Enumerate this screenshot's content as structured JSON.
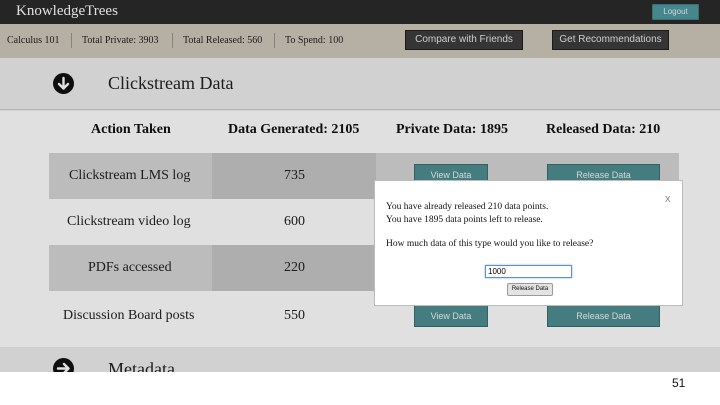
{
  "app": {
    "brand": "KnowledgeTrees",
    "logout_label": "Logout"
  },
  "stats": {
    "course": "Calculus 101",
    "total_private": "Total Private: 3903",
    "total_released": "Total Released: 560",
    "to_spend": "To Spend: 100",
    "compare_label": "Compare with Friends",
    "recommend_label": "Get Recommendations"
  },
  "clickstream": {
    "title": "Clickstream Data",
    "icon": "arrow-down-circle-icon",
    "columns": [
      "Action Taken",
      "Data Generated: 2105",
      "Private Data: 1895",
      "Released Data: 210"
    ],
    "rows": [
      {
        "action": "Clickstream LMS log",
        "generated": "735",
        "view_label": "View Data",
        "release_label": "Release Data"
      },
      {
        "action": "Clickstream video log",
        "generated": "600"
      },
      {
        "action": "PDFs accessed",
        "generated": "220"
      },
      {
        "action": "Discussion Board posts",
        "generated": "550",
        "view_label": "View Data",
        "release_label": "Release Data"
      }
    ]
  },
  "metadata": {
    "title": "Metadata",
    "icon": "arrow-right-circle-icon"
  },
  "modal": {
    "close": "x",
    "line1": "You have already released 210 data points.",
    "line2": "You have 1895 data points left to release.",
    "question": "How much data of this type would you like to release?",
    "input_value": "1000",
    "button_label": "Release Data"
  },
  "slide_number": "51",
  "colors": {
    "navbar": "#2b2b2b",
    "statsbar": "#cfc8bb",
    "teal": "#4f8e92",
    "accent": "#4f9aa0"
  }
}
